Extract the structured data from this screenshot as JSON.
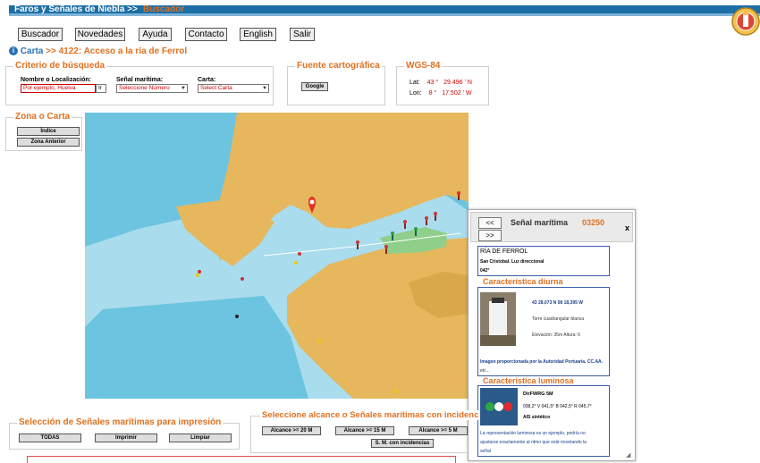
{
  "header": {
    "title": "Faros y Señales de Niebla >>",
    "section": "Buscador"
  },
  "nav": {
    "items": [
      "Buscador",
      "Novedades",
      "Ayuda",
      "Contacto",
      "English",
      "Salir"
    ]
  },
  "breadcrumb": {
    "carta": "Carta",
    "path": ">> 4122: Acceso a la ría de Ferrol"
  },
  "search": {
    "legend": "Criterio de búsqueda",
    "name_label": "Nombre o Localización:",
    "name_placeholder": "Por ejemplo, Huelva",
    "go_label": "Ir",
    "signal_label": "Señal marítima:",
    "signal_value": "Seleccione Número",
    "chart_label": "Carta:",
    "chart_value": "Select Carta"
  },
  "carto": {
    "legend": "Fuente cartográfica",
    "google_label": "Google"
  },
  "wgs": {
    "legend": "WGS-84",
    "lat_label": "Lat:",
    "lat_deg": "43",
    "lat_min": "29.496",
    "lat_hem": "N",
    "lon_label": "Lon:",
    "lon_deg": "8",
    "lon_min": "17.502",
    "lon_hem": "W",
    "deg_sym": "°",
    "min_sym": "'"
  },
  "zona": {
    "legend": "Zona o Carta",
    "index_label": "Índice",
    "prev_label": "Zona Anterior"
  },
  "popup": {
    "prev": "<<",
    "next": ">>",
    "title": "Señal marítima",
    "number": "03250",
    "close": "x",
    "place": "RÍA DE FERROL",
    "sub": "San Cristobal. Luz direccional",
    "code": "042°",
    "diurna_title": "Característica diurna",
    "coords": "43 28,073 N  08 18,395 W",
    "tower": "Torre cuadrangular blanca",
    "elev": "Elevación: 35m   Altura: 6",
    "photo_credit_1": "Imagen proporcionada por la Autoridad Portuaria, CC.AA.",
    "photo_credit_2": "etc...",
    "luminosa_title": "Característica luminosa",
    "light_code": "DirFWRG  5M",
    "sectors": "038,2° V 041,5° B 042,5° R 045,7°",
    "ais": "AIS sintético",
    "disclaimer_1": "La representación luminosa es un ejemplo, podría no",
    "disclaimer_2": "ajustarse exactamente al ritmo que esté mostrando la",
    "disclaimer_3": "señal"
  },
  "print_section": {
    "legend": "Selección de Señales marítimas para impresión",
    "all": "TODAS",
    "print": "Imprimir",
    "clear": "Limpiar"
  },
  "range_section": {
    "legend": "Seleccione alcance o Señales marítimas con incidenc",
    "r20": "Alcance >= 20 M",
    "r15": "Alcance >= 15 M",
    "r5": "Alcance >= 5 M",
    "incid": "S. M. con incidencias"
  },
  "colors": {
    "brand_blue": "#1b6fa6",
    "accent_orange": "#e07020",
    "sea": "#a9dced",
    "deep_sea": "#6cc4e0",
    "land": "#e6b75c"
  }
}
